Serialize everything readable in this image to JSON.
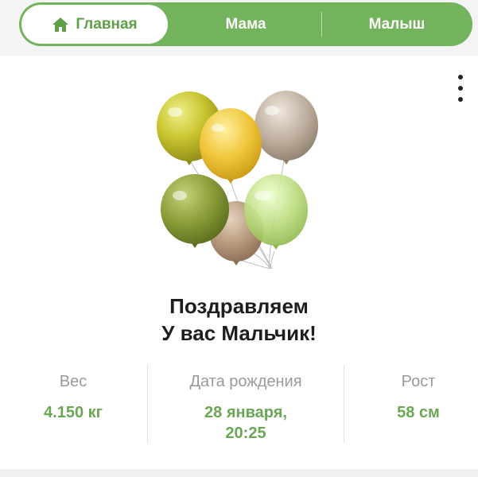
{
  "nav": {
    "tabs": [
      {
        "label": "Главная",
        "icon": "home-icon",
        "active": true
      },
      {
        "label": "Мама",
        "active": false
      },
      {
        "label": "Малыш",
        "active": false
      }
    ],
    "accent": "#72b35c"
  },
  "card": {
    "menu_icon": "more-vertical-icon",
    "image": "balloons-illustration",
    "headline_line1": "Поздравляем",
    "headline_line2": "У вас Мальчик!"
  },
  "stats": {
    "weight": {
      "label": "Вес",
      "value": "4.150 кг"
    },
    "birth_date": {
      "label": "Дата рождения",
      "value_line1": "28 января,",
      "value_line2": "20:25"
    },
    "height": {
      "label": "Рост",
      "value": "58 см"
    }
  }
}
